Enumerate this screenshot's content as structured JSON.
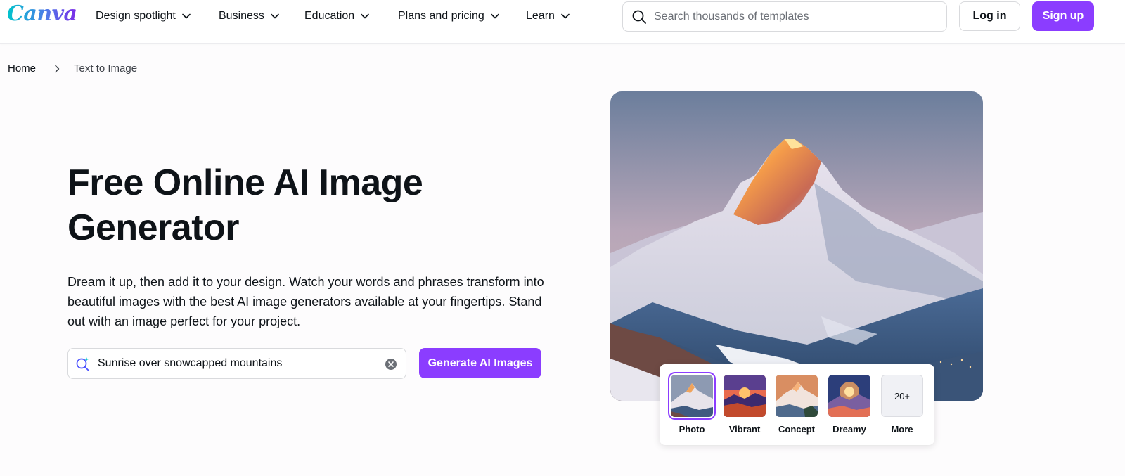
{
  "header": {
    "logo_text": "Canva",
    "nav": [
      {
        "label": "Design spotlight"
      },
      {
        "label": "Business"
      },
      {
        "label": "Education"
      },
      {
        "label": "Plans and pricing"
      },
      {
        "label": "Learn"
      }
    ],
    "search_placeholder": "Search thousands of templates",
    "login_label": "Log in",
    "signup_label": "Sign up"
  },
  "breadcrumb": {
    "home": "Home",
    "current": "Text to Image"
  },
  "hero": {
    "title": "Free Online AI Image Generator",
    "subtitle": "Dream it up, then add it to your design. Watch your words and phrases transform into beautiful images with the best AI image generators available at your fingertips. Stand out with an image perfect for your project.",
    "prompt_value": "Sunrise over snowcapped mountains",
    "generate_label": "Generate AI Images"
  },
  "styles": {
    "selected": "Photo",
    "options": [
      {
        "label": "Photo"
      },
      {
        "label": "Vibrant"
      },
      {
        "label": "Concept"
      },
      {
        "label": "Dreamy"
      },
      {
        "label": "More",
        "badge": "20+"
      }
    ]
  },
  "colors": {
    "brand_purple": "#8b3dff",
    "logo_gradient_start": "#00c4cc",
    "logo_gradient_end": "#7d2ae8"
  }
}
